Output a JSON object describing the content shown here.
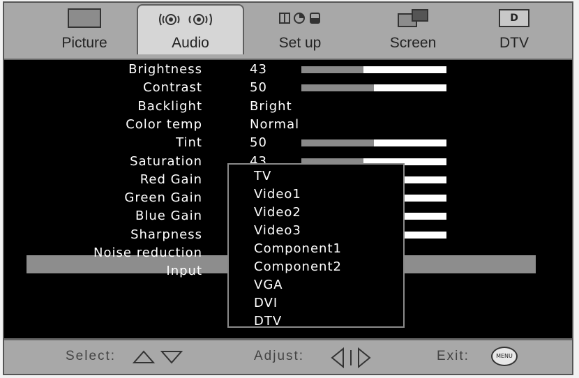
{
  "tabs": [
    {
      "label": "Picture",
      "icon": "picture-icon",
      "selected": false
    },
    {
      "label": "Audio",
      "icon": "speaker-icon",
      "selected": true
    },
    {
      "label": "Set up",
      "icon": "setup-icon",
      "selected": false
    },
    {
      "label": "Screen",
      "icon": "screen-icon",
      "selected": false
    },
    {
      "label": "DTV",
      "icon": "dtv-icon",
      "icon_text": "D",
      "selected": false
    }
  ],
  "settings": [
    {
      "name": "Brightness",
      "value": "43",
      "level": 0.43
    },
    {
      "name": "Contrast",
      "value": "50",
      "level": 0.5
    },
    {
      "name": "Backlight",
      "value": "Bright"
    },
    {
      "name": "Color temp",
      "value": "Normal"
    },
    {
      "name": "Tint",
      "value": "50",
      "level": 0.5
    },
    {
      "name": "Saturation",
      "value": "43",
      "level": 0.43
    },
    {
      "name": "Red Gain"
    },
    {
      "name": "Green Gain"
    },
    {
      "name": "Blue Gain"
    },
    {
      "name": "Sharpness"
    },
    {
      "name": "Noise reduction"
    },
    {
      "name": "Input",
      "highlighted": true
    }
  ],
  "input_options": [
    "TV",
    "Video1",
    "Video2",
    "Video3",
    "Component1",
    "Component2",
    "VGA",
    "DVI",
    "DTV"
  ],
  "footer": {
    "select_label": "Select:",
    "adjust_label": "Adjust:",
    "exit_label": "Exit:",
    "menu_button_label": "MENU"
  },
  "colors": {
    "highlight": "#8d8d8d",
    "tab_bar": "#a8a8a8",
    "bar_fill": "#8a8a8a",
    "bar_track": "#ffffff"
  }
}
